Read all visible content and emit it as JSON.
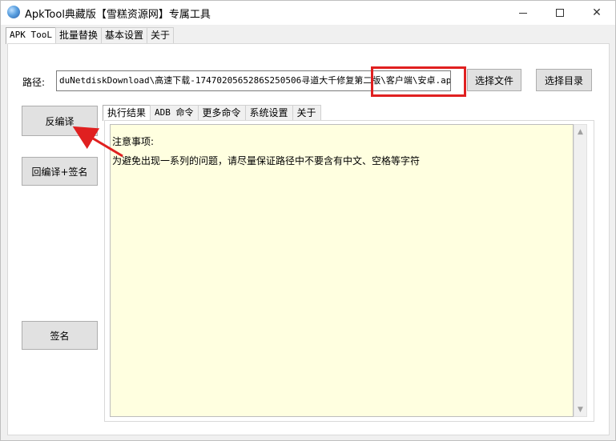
{
  "window": {
    "title": "ApkTool典藏版【雪糕资源网】专属工具"
  },
  "top_tabs": [
    {
      "label": "APK TooL"
    },
    {
      "label": "批量替换"
    },
    {
      "label": "基本设置"
    },
    {
      "label": "关于"
    }
  ],
  "path": {
    "label": "路径:",
    "value": "duNetdiskDownload\\高速下载-1747020565286S250506寻道大千修复第二版\\客户端\\安卓.apk"
  },
  "buttons": {
    "select_file": "选择文件",
    "select_dir": "选择目录",
    "decompile": "反编译",
    "recompile_sign": "回编译+签名",
    "sign": "签名"
  },
  "inner_tabs": [
    {
      "label": "执行结果"
    },
    {
      "label": "ADB 命令"
    },
    {
      "label": "更多命令"
    },
    {
      "label": "系统设置"
    },
    {
      "label": "关于"
    }
  ],
  "output": {
    "lines": [
      "注意事项:",
      "为避免出现一系列的问题，请尽量保证路径中不要含有中文、空格等字符"
    ]
  },
  "colors": {
    "highlight": "#e02020",
    "output_bg": "#ffffe0",
    "arrow": "#e02020"
  }
}
